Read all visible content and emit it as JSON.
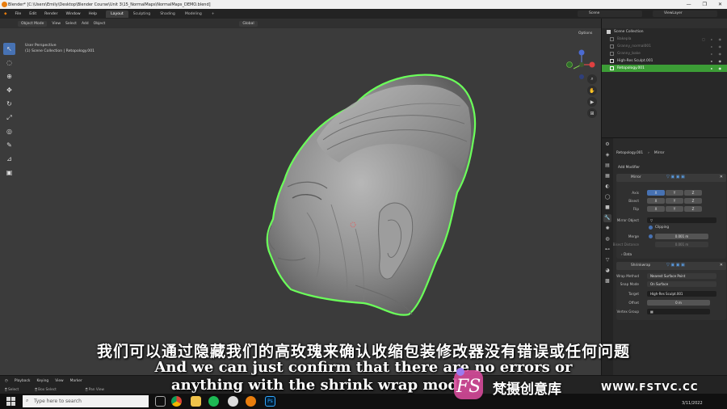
{
  "window": {
    "title": "Blender* [C:\\Users\\Emily\\Desktop\\Blender Course\\Unit 3\\15_NormalMaps\\NormalMaps_DEMO.blend]",
    "controls": [
      "—",
      "❐",
      "✕"
    ]
  },
  "menubar": {
    "menus": [
      "File",
      "Edit",
      "Render",
      "Window",
      "Help"
    ],
    "workspaces": [
      "Layout",
      "Sculpting",
      "Shading",
      "Modeling",
      "+"
    ],
    "active_workspace": "Layout",
    "scene": "Scene",
    "view_layer": "ViewLayer"
  },
  "viewport": {
    "header_items": [
      "Object Mode",
      "View",
      "Select",
      "Add",
      "Object"
    ],
    "transform": "Global",
    "info_line1": "User Perspective",
    "info_line2": "(1) Scene Collection | Retopology.001",
    "options_label": "Options",
    "tools": [
      "cursor-select",
      "circle-select",
      "cursor",
      "move",
      "rotate",
      "scale",
      "transform",
      "annotate",
      "measure",
      "add-cube"
    ]
  },
  "outliner": {
    "root": "Scene Collection",
    "items": [
      {
        "label": "Bakepla",
        "state": "dim"
      },
      {
        "label": "Granny_normal001",
        "state": "dim"
      },
      {
        "label": "Granny_bake",
        "state": "dim"
      },
      {
        "label": "High-Res Sculpt.001",
        "state": "normal"
      },
      {
        "label": "Retopology.001",
        "state": "selected"
      }
    ]
  },
  "properties": {
    "object_name": "Retopology.001",
    "modifier_name_breadcrumb": "Mirror",
    "add_modifier": "Add Modifier",
    "mirror": {
      "name": "Mirror",
      "axis_label": "Axis",
      "bisect_label": "Bisect",
      "flip_label": "Flip",
      "axes": [
        "X",
        "Y",
        "Z"
      ],
      "mirror_object_label": "Mirror Object",
      "clipping_label": "Clipping",
      "merge_label": "Merge",
      "merge_value": "0.001 m",
      "bisect_distance_label": "Bisect Distance",
      "bisect_distance_value": "0.001 m",
      "data_label": "Data"
    },
    "shrinkwrap": {
      "name": "Shrinkwrap",
      "wrap_method_label": "Wrap Method",
      "wrap_method_value": "Nearest Surface Point",
      "snap_mode_label": "Snap Mode",
      "snap_mode_value": "On Surface",
      "target_label": "Target",
      "target_value": "High-Res Sculpt.001",
      "offset_label": "Offset",
      "offset_value": "0 m",
      "vertex_group_label": "Vertex Group"
    }
  },
  "timeline": {
    "items": [
      "Playback",
      "Keying",
      "View",
      "Marker"
    ]
  },
  "statusbar": {
    "items": [
      "Select",
      "Box Select",
      "Pan View"
    ]
  },
  "taskbar": {
    "search_placeholder": "Type here to search",
    "date": "3/11/2022"
  },
  "subtitles": {
    "chinese": "我们可以通过隐藏我们的高玫瑰来确认收缩包装修改器没有错误或任何问题",
    "english_line1": "And we can just confirm that there are no errors or",
    "english_line2": "anything with the shrink wrap mod"
  },
  "watermark": {
    "brand_cn": "梵摄创意库",
    "url": "WWW.FSTVC.CC"
  },
  "colors": {
    "accent_blue": "#4772b3",
    "selection_green": "#3c9d36",
    "outline_green": "#6bff5a"
  }
}
